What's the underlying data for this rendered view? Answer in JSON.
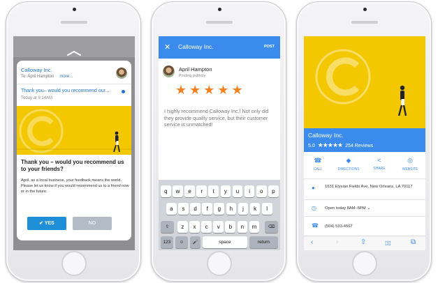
{
  "phone1": {
    "from": "Calloway Inc.",
    "to": "To: April Hampton",
    "more": "more...",
    "subject": "Thank you– would you recommend our...",
    "time": "Today at 9:14AM",
    "headline": "Thank you – would you recommend us to your friends?",
    "body": "April, as a local business, your feedback means the world. Please let us know if you would recommend us to a friend now or in the future.",
    "yes_label": "✔ YES",
    "no_label": "NO"
  },
  "phone2": {
    "close": "✕",
    "title": "Calloway Inc.",
    "post_label": "POST",
    "user_name": "April Hampton",
    "user_sub": "Posting publicly",
    "stars": "★★★★★",
    "rating_value": 5,
    "review": "I highly recommend Calloway Inc.! Not only did they provide quality service, but their customer service is unmatched!",
    "keyboard": {
      "row1": [
        "q",
        "w",
        "e",
        "r",
        "t",
        "y",
        "u",
        "i",
        "o",
        "p"
      ],
      "row2": [
        "a",
        "s",
        "d",
        "f",
        "g",
        "h",
        "j",
        "k",
        "l"
      ],
      "row3": [
        "z",
        "x",
        "c",
        "v",
        "b",
        "n",
        "m"
      ],
      "shift": "⇧",
      "delete": "⌫",
      "num": "123",
      "emoji": "☺",
      "mic": "🎤",
      "space": "space",
      "return": "return"
    }
  },
  "phone3": {
    "name": "Calloway Inc.",
    "rating": "5.0",
    "stars": "★★★★★",
    "reviews": "254 Reviews",
    "actions": [
      {
        "icon": "☎",
        "label": "CALL"
      },
      {
        "icon": "◆",
        "label": "DIRECTIONS"
      },
      {
        "icon": "<",
        "label": "SHARE"
      },
      {
        "icon": "◎",
        "label": "WEBSITE"
      }
    ],
    "address": "1631 Elysian Fields Ave, New Orleans, LA 70117",
    "hours": "Open today 8AM–5PM",
    "hours_chevron": "⌄",
    "phone": "(504) 533-4567",
    "bar": {
      "back": "‹",
      "forward": "›",
      "share": "⇧",
      "bookmarks": "▯▯",
      "tabs": "⧉"
    }
  },
  "colors": {
    "accent": "#3b8bec",
    "star": "#f58220",
    "yellow": "#f4c800",
    "yes": "#1e8fd6",
    "no": "#b3bcc4"
  }
}
